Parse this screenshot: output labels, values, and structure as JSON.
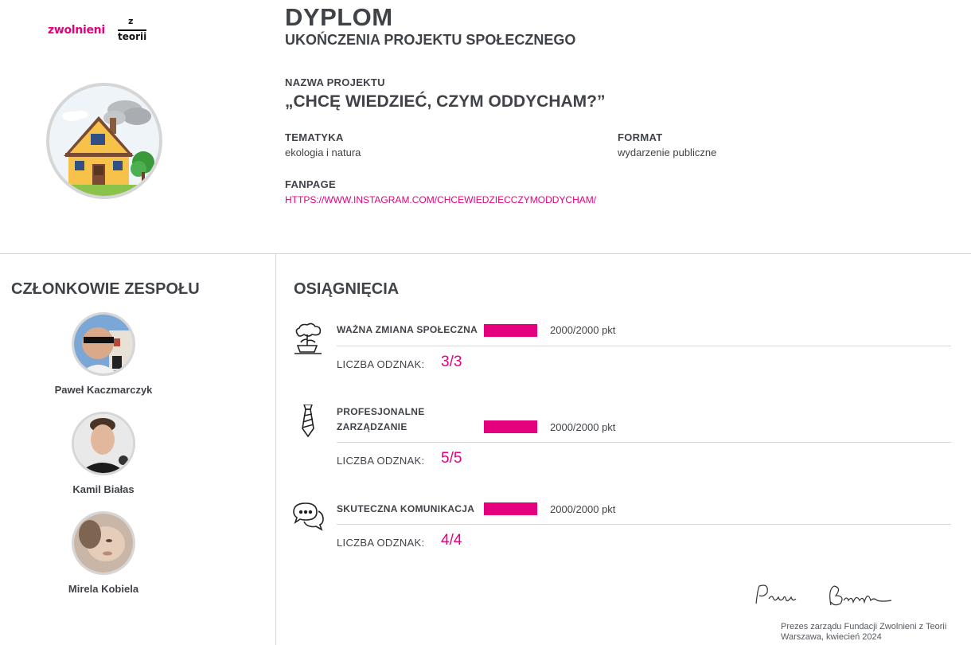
{
  "logo": {
    "brand": "zwolnieni",
    "z": "z",
    "teorii": "teorii"
  },
  "header": {
    "title": "DYPLOM",
    "subtitle": "UKOŃCZENIA PROJEKTU SPOŁECZNEGO"
  },
  "project": {
    "name_label": "NAZWA PROJEKTU",
    "name": "„CHCĘ WIEDZIEĆ, CZYM ODDYCHAM?”",
    "tematyka_label": "TEMATYKA",
    "tematyka": "ekologia i natura",
    "format_label": "FORMAT",
    "format": "wydarzenie publiczne",
    "fanpage_label": "FANPAGE",
    "fanpage": "HTTPS://WWW.INSTAGRAM.COM/CHCEWIEDZIECCZYMODDYCHAM/"
  },
  "members": {
    "title": "CZŁONKOWIE ZESPOŁU",
    "items": [
      {
        "name": "Paweł Kaczmarczyk"
      },
      {
        "name": "Kamil Białas"
      },
      {
        "name": "Mirela Kobiela"
      }
    ]
  },
  "achievements": {
    "title": "OSIĄGNIĘCIA",
    "badge_label": "LICZBA ODZNAK:",
    "items": [
      {
        "name": "WAŻNA ZMIANA SPOŁECZNA",
        "points": "2000/2000 pkt",
        "progress": 1.0,
        "badges": "3/3",
        "icon": "bonsai-tree-icon"
      },
      {
        "name_line1": "PROFESJONALNE",
        "name_line2": "ZARZĄDZANIE",
        "points": "2000/2000 pkt",
        "progress": 1.0,
        "badges": "5/5",
        "icon": "necktie-icon"
      },
      {
        "name": "SKUTECZNA KOMUNIKACJA",
        "points": "2000/2000 pkt",
        "progress": 1.0,
        "badges": "4/4",
        "icon": "chat-bubbles-icon"
      }
    ]
  },
  "footer": {
    "signature_text": "Paula Bronska",
    "caption_line1": "Prezes zarządu Fundacji Zwolnieni z Teorii",
    "caption_line2": "Warszawa, kwiecień 2024"
  },
  "colors": {
    "accent": "#e5007d",
    "text": "#3f4348",
    "divider": "#d8d8d8"
  }
}
